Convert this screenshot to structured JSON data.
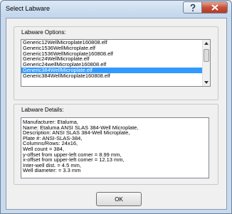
{
  "window": {
    "title": "Select Labware",
    "help_icon": "?",
    "close_icon": "x"
  },
  "options": {
    "label": "Labware Options:",
    "items": [
      "Generic12WellMicroplate160808.elf",
      "Generic1536WellMicroplate.elf",
      "Generic1536WellMicroplate160808.elf",
      "Generic24WellMicroplate.elf",
      "Generic24wellMicroplate160808.elf",
      "Generic384WellMicroplate.elf",
      "Generic384WellMicroplate160808.elf"
    ],
    "selected_index": 5
  },
  "details": {
    "label": "Labware Details:",
    "lines": [
      "Manufacturer: Etaluma,",
      "Name: Etaluma ANSI SLAS 384-Well Microplate,",
      "Description: ANSI SLAS 384-Well Microplate,",
      "Plate #: ANSI-SLAS-384,",
      "Columns/Rows: 24x16,",
      "Well count = 384,",
      "y-offset from upper-left corner = 8.99 mm,",
      "x-offset from upper-left corner = 12.13 mm,",
      "Inter-well dist. = 4.5 mm,",
      "Well diameter: = 3.3 mm"
    ]
  },
  "buttons": {
    "ok_label": "OK"
  }
}
